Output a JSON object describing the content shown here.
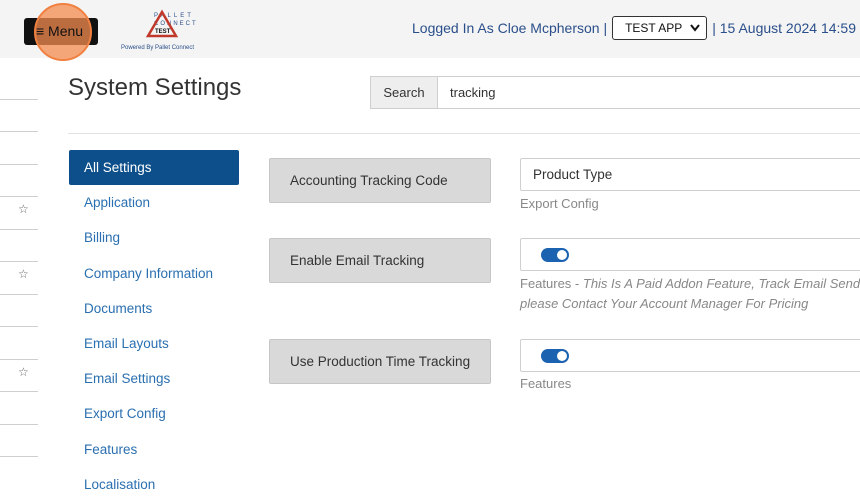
{
  "header": {
    "menu_label": "≡ Menu",
    "logo_tagline": "Powered By Pallet Connect",
    "logo_text_line1": "PALLET",
    "logo_text_line2": "CONNECT",
    "logo_badge": "TEST",
    "logged_in_text": "Logged In As Cloe Mcpherson |",
    "app_select_value": "TEST APP",
    "datetime": "| 15 August 2024 14:59"
  },
  "page": {
    "title": "System Settings"
  },
  "search": {
    "label": "Search",
    "value": "tracking"
  },
  "nav": {
    "items": [
      {
        "label": "All Settings",
        "active": true
      },
      {
        "label": "Application"
      },
      {
        "label": "Billing"
      },
      {
        "label": "Company Information"
      },
      {
        "label": "Documents"
      },
      {
        "label": "Email Layouts"
      },
      {
        "label": "Email Settings"
      },
      {
        "label": "Export Config"
      },
      {
        "label": "Features"
      },
      {
        "label": "Localisation"
      }
    ]
  },
  "settings": [
    {
      "label": "Accounting Tracking Code",
      "value": "Product Type",
      "category": "Export Config",
      "note": ""
    },
    {
      "label": "Enable Email Tracking",
      "toggle_on": true,
      "category": "Features",
      "note_line1": "This Is A Paid Addon Feature, Track Email Sending",
      "note_line2": "please Contact Your Account Manager For Pricing"
    },
    {
      "label": "Use Production Time Tracking",
      "toggle_on": true,
      "category": "Features",
      "note": ""
    }
  ],
  "colors": {
    "accent": "#0d4f8a",
    "link": "#2a6fb0",
    "toggle": "#1b62b0",
    "highlight": "#f08040"
  }
}
